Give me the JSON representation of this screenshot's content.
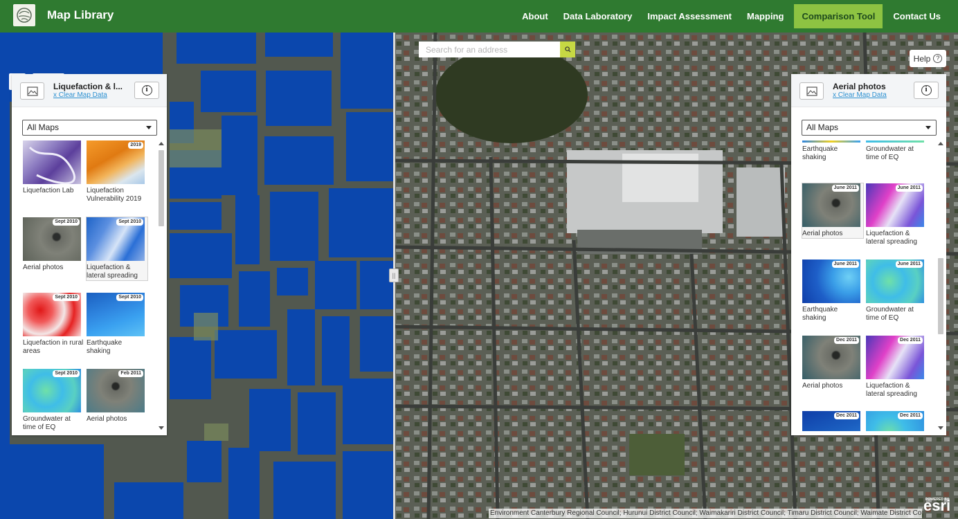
{
  "header": {
    "title": "Map Library",
    "nav": [
      {
        "label": "About",
        "active": false
      },
      {
        "label": "Data Laboratory",
        "active": false
      },
      {
        "label": "Impact Assessment",
        "active": false
      },
      {
        "label": "Mapping",
        "active": false
      },
      {
        "label": "Comparison Tool",
        "active": true
      },
      {
        "label": "Contact Us",
        "active": false
      }
    ]
  },
  "colors": {
    "header": "#2f7a30",
    "active_nav": "#8dc342",
    "water_blue": "#0b47ad",
    "link": "#2a8fd0"
  },
  "search": {
    "placeholder": "Search for an address"
  },
  "help": {
    "label": "Help"
  },
  "left_panel": {
    "title": "Liquefaction & l...",
    "clear": "x Clear Map Data",
    "filter": "All Maps",
    "items": [
      {
        "label": "Liquefaction Lab",
        "badge": "",
        "thumb": "purple"
      },
      {
        "label": "Liquefaction Vulnerability 2019",
        "badge": "2019",
        "thumb": "orange"
      },
      {
        "label": "Aerial photos",
        "badge": "Sept 2010",
        "thumb": "aerial"
      },
      {
        "label": "Liquefaction & lateral spreading",
        "badge": "Sept 2010",
        "thumb": "spread"
      },
      {
        "label": "Liquefaction in rural areas",
        "badge": "Sept 2010",
        "thumb": "red"
      },
      {
        "label": "Earthquake shaking",
        "badge": "Sept 2010",
        "thumb": "shaking"
      },
      {
        "label": "Groundwater at time of EQ",
        "badge": "Sept 2010",
        "thumb": "groundwater"
      },
      {
        "label": "Aerial photos",
        "badge": "Feb 2011",
        "thumb": "aerial"
      }
    ]
  },
  "right_panel": {
    "title": "Aerial photos",
    "clear": "x Clear Map Data",
    "filter": "All Maps",
    "items": [
      {
        "label": "Earthquake shaking",
        "badge": "",
        "thumb": "shaking"
      },
      {
        "label": "Groundwater at time of EQ",
        "badge": "",
        "thumb": "groundwater"
      },
      {
        "label": "Aerial photos",
        "badge": "June 2011",
        "thumb": "aerial"
      },
      {
        "label": "Liquefaction & lateral spreading",
        "badge": "June 2011",
        "thumb": "spread"
      },
      {
        "label": "Earthquake shaking",
        "badge": "June 2011",
        "thumb": "shaking"
      },
      {
        "label": "Groundwater at time of EQ",
        "badge": "June 2011",
        "thumb": "groundwater"
      },
      {
        "label": "Aerial photos",
        "badge": "Dec 2011",
        "thumb": "aerial"
      },
      {
        "label": "Liquefaction & lateral spreading",
        "badge": "Dec 2011",
        "thumb": "spread"
      },
      {
        "label": "",
        "badge": "Dec 2011",
        "thumb": "shaking"
      },
      {
        "label": "",
        "badge": "Dec 2011",
        "thumb": "groundwater"
      }
    ]
  },
  "attribution": "Environment Canterbury Regional Council; Hurunui District Council; Waimakariri District Council; Timaru District Council; Waimate District Cou...",
  "esri": {
    "powered": "POWERED BY",
    "logo": "esri"
  }
}
